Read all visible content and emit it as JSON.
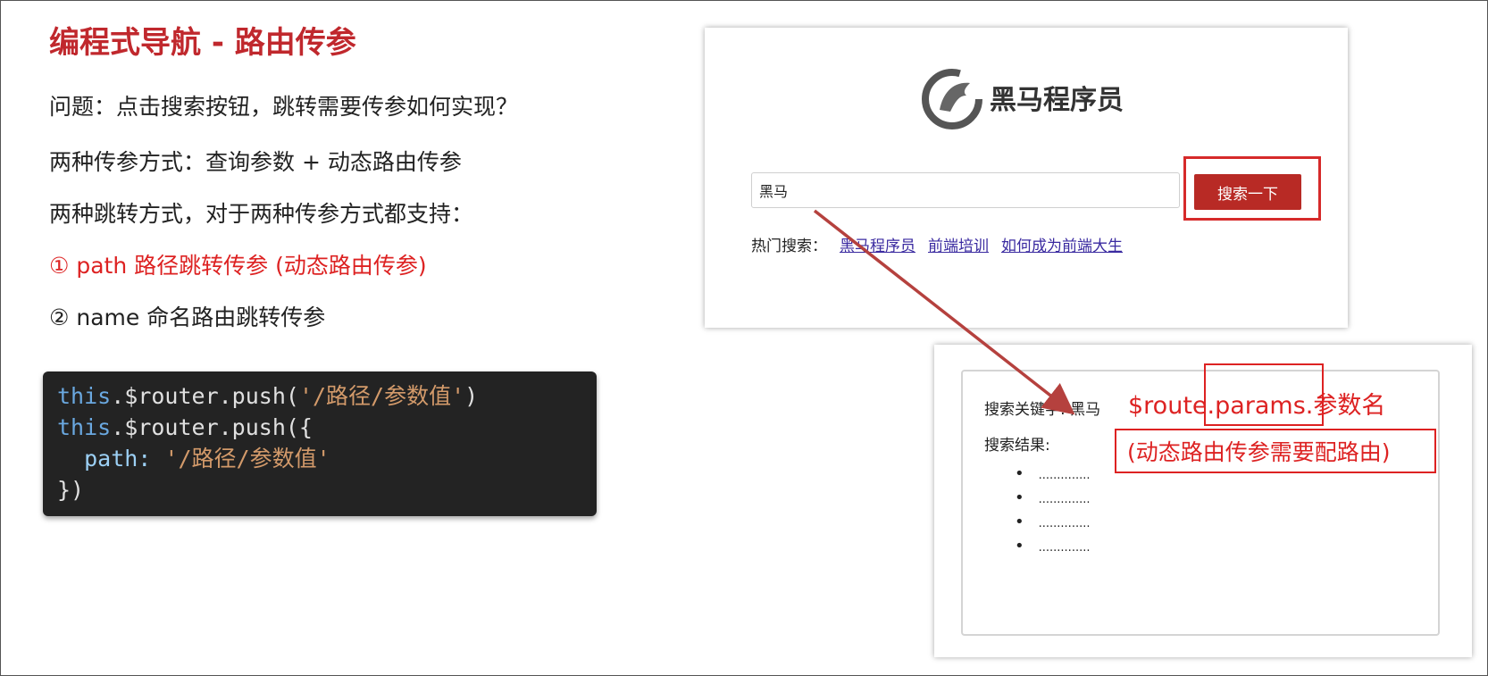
{
  "slide": {
    "title": "编程式导航 - 路由传参",
    "question": "问题：点击搜索按钮，跳转需要传参如何实现？",
    "line_two_ways_params": "两种传参方式：查询参数 + 动态路由传参",
    "line_two_ways_jump": "两种跳转方式，对于两种传参方式都支持：",
    "option_path": "① path 路径跳转传参 (动态路由传参)",
    "option_name": "② name 命名路由跳转传参"
  },
  "code": {
    "line1_kw": "this",
    "line1_rest": ".$router.push(",
    "line1_str": "'/路径/参数值'",
    "line1_end": ")",
    "line2_kw": "this",
    "line2_rest": ".$router.push({",
    "line3_prop": "  path: ",
    "line3_str": "'/路径/参数值'",
    "line4": "})"
  },
  "search_page": {
    "logo_text": "黑马程序员",
    "input_value": "黑马",
    "button_label": "搜索一下",
    "hot_label": "热门搜索：",
    "hot_links": [
      "黑马程序员",
      "前端培训",
      "如何成为前端大生"
    ]
  },
  "result_page": {
    "keyword_label": "搜索关键字: 黑马",
    "result_label": "搜索结果:",
    "items": [
      "..............",
      "..............",
      "..............",
      ".............."
    ],
    "route_expr": "$route.params.参数名",
    "note": "(动态路由传参需要配路由)"
  },
  "colors": {
    "accent": "#c0282d",
    "highlight": "#d62a2a",
    "button": "#b82a25"
  }
}
